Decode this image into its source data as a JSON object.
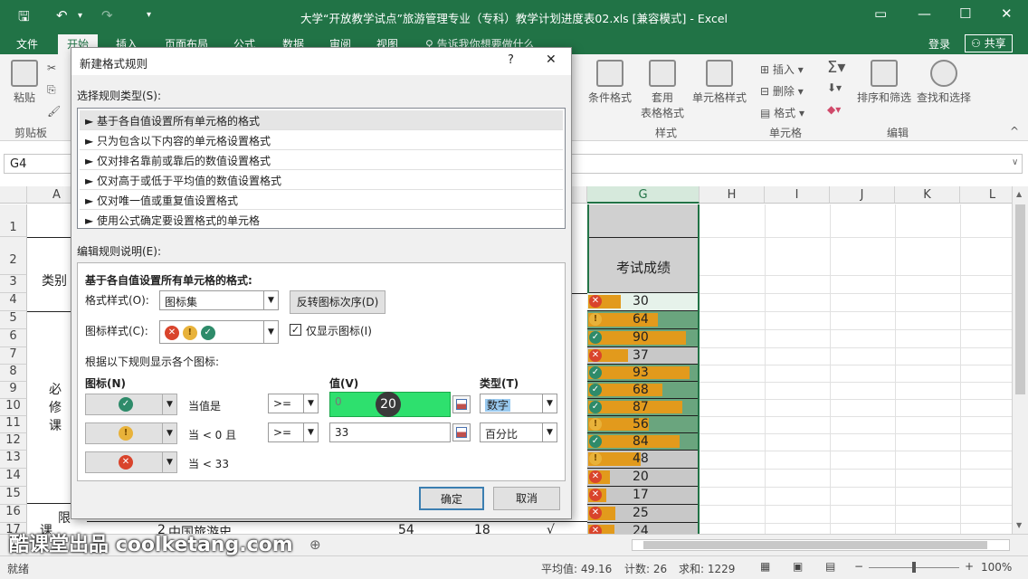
{
  "window": {
    "title": "大学“开放教学试点”旅游管理专业（专科）教学计划进度表02.xls  [兼容模式] - Excel",
    "login": "登录",
    "share": "共享"
  },
  "ribbon_tabs": [
    "文件",
    "开始",
    "插入",
    "页面布局",
    "公式",
    "数据",
    "审阅",
    "视图"
  ],
  "tell_me": "告诉我你想要做什么",
  "ribbon": {
    "paste": "粘贴",
    "clipboard_group": "剪贴板",
    "conditional_format": "条件格式",
    "table_format_1": "套用",
    "table_format_2": "表格格式",
    "cell_styles": "单元格样式",
    "styles_group": "样式",
    "insert": "插入",
    "delete": "删除",
    "format": "格式",
    "cells_group": "单元格",
    "sort_filter": "排序和筛选",
    "find_select": "查找和选择",
    "editing_group": "编辑"
  },
  "name_box": "G4",
  "columns": [
    "A",
    "G",
    "H",
    "I",
    "J",
    "K",
    "L"
  ],
  "rows": [
    "1",
    "2",
    "3",
    "4",
    "5",
    "6",
    "7",
    "8",
    "9",
    "10",
    "11",
    "12",
    "13",
    "14",
    "15",
    "16",
    "17"
  ],
  "sheet_cells": {
    "title_fragment": "度表",
    "header_g": "考试成绩",
    "category": "类别",
    "required_1": "必",
    "required_2": "修",
    "required_3": "课",
    "limited_1": "限",
    "limited_2": "课",
    "row17_num": "2",
    "row17_course": "中国旅游史",
    "row17_v1": "54",
    "row17_v2": "18",
    "row17_check": "√"
  },
  "chart_data": {
    "type": "table",
    "column": "考试成绩",
    "values": [
      30,
      64,
      90,
      37,
      93,
      68,
      87,
      56,
      84,
      48,
      20,
      17,
      25,
      24
    ],
    "icons": [
      "x",
      "warn",
      "ok",
      "x",
      "ok",
      "ok",
      "ok",
      "warn",
      "ok",
      "warn",
      "x",
      "x",
      "x",
      "x"
    ]
  },
  "dialog": {
    "title": "新建格式规则",
    "help": "?",
    "close": "✕",
    "select_rule_type": "选择规则类型(S):",
    "rule_types": [
      "► 基于各自值设置所有单元格的格式",
      "► 只为包含以下内容的单元格设置格式",
      "► 仅对排名靠前或靠后的数值设置格式",
      "► 仅对高于或低于平均值的数值设置格式",
      "► 仅对唯一值或重复值设置格式",
      "► 使用公式确定要设置格式的单元格"
    ],
    "edit_rule_desc": "编辑规则说明(E):",
    "format_all_cells": "基于各自值设置所有单元格的格式:",
    "format_style_label": "格式样式(O):",
    "format_style_value": "图标集",
    "reverse_icon_order": "反转图标次序(D)",
    "icon_style_label": "图标样式(C):",
    "show_icon_only": "仅显示图标(I)",
    "display_rules_label": "根据以下规则显示各个图标:",
    "icon_header": "图标(N)",
    "value_header": "值(V)",
    "type_header": "类型(T)",
    "row1_when": "当值是",
    "row1_op": ">=",
    "row1_value": "0",
    "row1_type": "数字",
    "row2_when": "当 < 0 且",
    "row2_op": ">=",
    "row2_value": "33",
    "row2_type": "百分比",
    "row3_when": "当 < 33",
    "ok": "确定",
    "cancel": "取消",
    "click_marker": "20"
  },
  "status": {
    "ready": "就绪",
    "average": "平均值: 49.16",
    "count": "计数: 26",
    "sum": "求和: 1229",
    "zoom": "100%"
  },
  "watermark": "酷课堂出品 coolketang.com",
  "colors": {
    "excel_green": "#217346",
    "bar_orange": "#e29a1c",
    "icon_red": "#d9442c",
    "icon_green": "#2e8b6a",
    "icon_yellow": "#e8b23a",
    "highlight_green": "#2ee06e"
  }
}
